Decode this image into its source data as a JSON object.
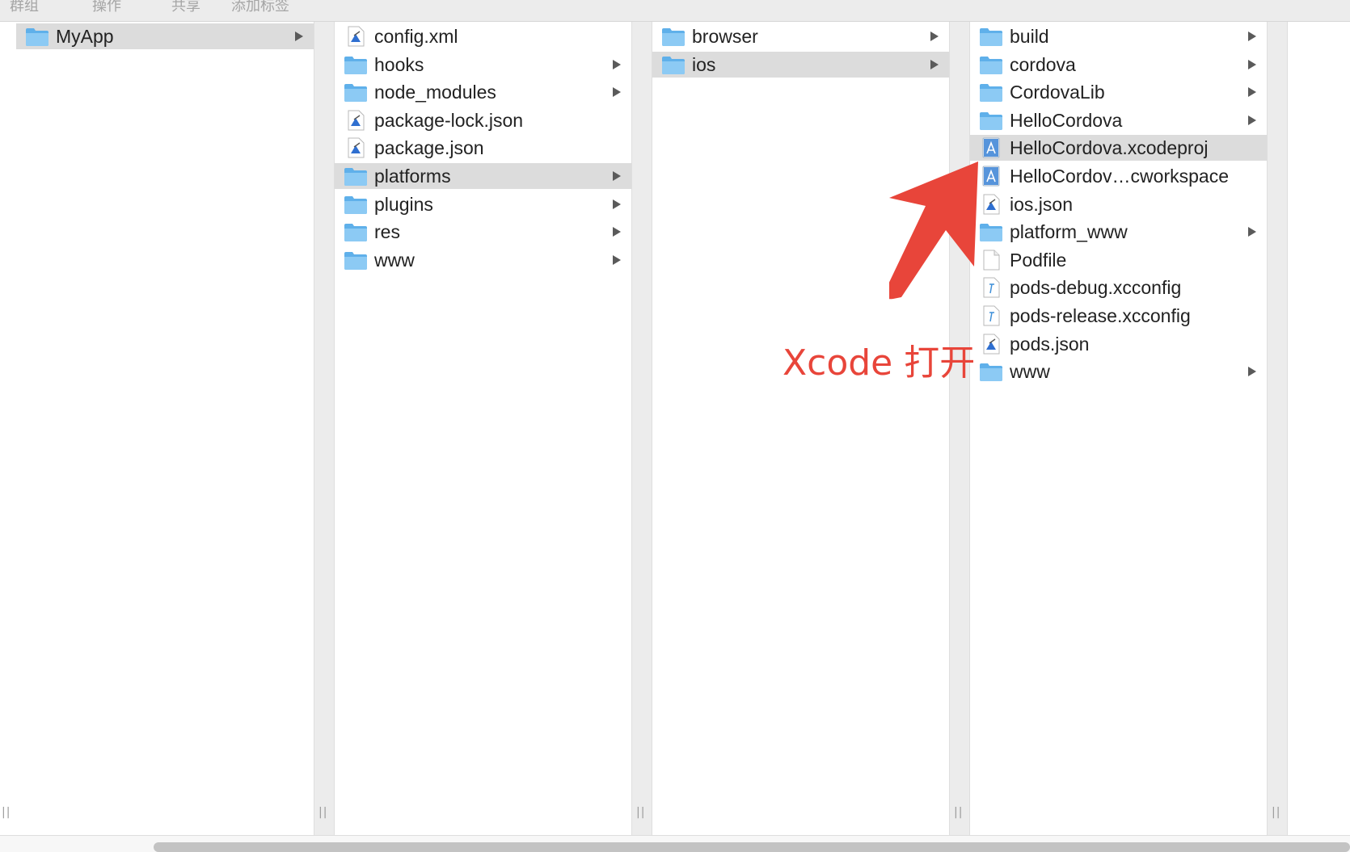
{
  "toolbar": {
    "items": [
      "群组",
      "操作",
      "共享",
      "添加标签"
    ]
  },
  "columns": [
    {
      "items": [
        {
          "label": "MyApp",
          "type": "folder",
          "expandable": true,
          "selected": true
        }
      ]
    },
    {
      "items": [
        {
          "label": "config.xml",
          "type": "doc",
          "expandable": false,
          "selected": false
        },
        {
          "label": "hooks",
          "type": "folder",
          "expandable": true,
          "selected": false
        },
        {
          "label": "node_modules",
          "type": "folder",
          "expandable": true,
          "selected": false
        },
        {
          "label": "package-lock.json",
          "type": "doc",
          "expandable": false,
          "selected": false
        },
        {
          "label": "package.json",
          "type": "doc",
          "expandable": false,
          "selected": false
        },
        {
          "label": "platforms",
          "type": "folder",
          "expandable": true,
          "selected": true
        },
        {
          "label": "plugins",
          "type": "folder",
          "expandable": true,
          "selected": false
        },
        {
          "label": "res",
          "type": "folder",
          "expandable": true,
          "selected": false
        },
        {
          "label": "www",
          "type": "folder",
          "expandable": true,
          "selected": false
        }
      ]
    },
    {
      "items": [
        {
          "label": "browser",
          "type": "folder",
          "expandable": true,
          "selected": false
        },
        {
          "label": "ios",
          "type": "folder",
          "expandable": true,
          "selected": true
        }
      ]
    },
    {
      "items": [
        {
          "label": "build",
          "type": "folder",
          "expandable": true,
          "selected": false
        },
        {
          "label": "cordova",
          "type": "folder",
          "expandable": true,
          "selected": false
        },
        {
          "label": "CordovaLib",
          "type": "folder",
          "expandable": true,
          "selected": false
        },
        {
          "label": "HelloCordova",
          "type": "folder",
          "expandable": true,
          "selected": false
        },
        {
          "label": "HelloCordova.xcodeproj",
          "type": "xcode",
          "expandable": false,
          "selected": true
        },
        {
          "label": "HelloCordov…cworkspace",
          "type": "xcode",
          "expandable": false,
          "selected": false
        },
        {
          "label": "ios.json",
          "type": "doc",
          "expandable": false,
          "selected": false
        },
        {
          "label": "platform_www",
          "type": "folder",
          "expandable": true,
          "selected": false
        },
        {
          "label": "Podfile",
          "type": "blank",
          "expandable": false,
          "selected": false
        },
        {
          "label": "pods-debug.xcconfig",
          "type": "config",
          "expandable": false,
          "selected": false
        },
        {
          "label": "pods-release.xcconfig",
          "type": "config",
          "expandable": false,
          "selected": false
        },
        {
          "label": "pods.json",
          "type": "doc",
          "expandable": false,
          "selected": false
        },
        {
          "label": "www",
          "type": "folder",
          "expandable": true,
          "selected": false
        }
      ]
    }
  ],
  "annotation": {
    "text": "Xcode 打开",
    "color": "#e8453a"
  },
  "colors": {
    "folder": "#6cb8ee",
    "selection": "#dcdcdc"
  }
}
